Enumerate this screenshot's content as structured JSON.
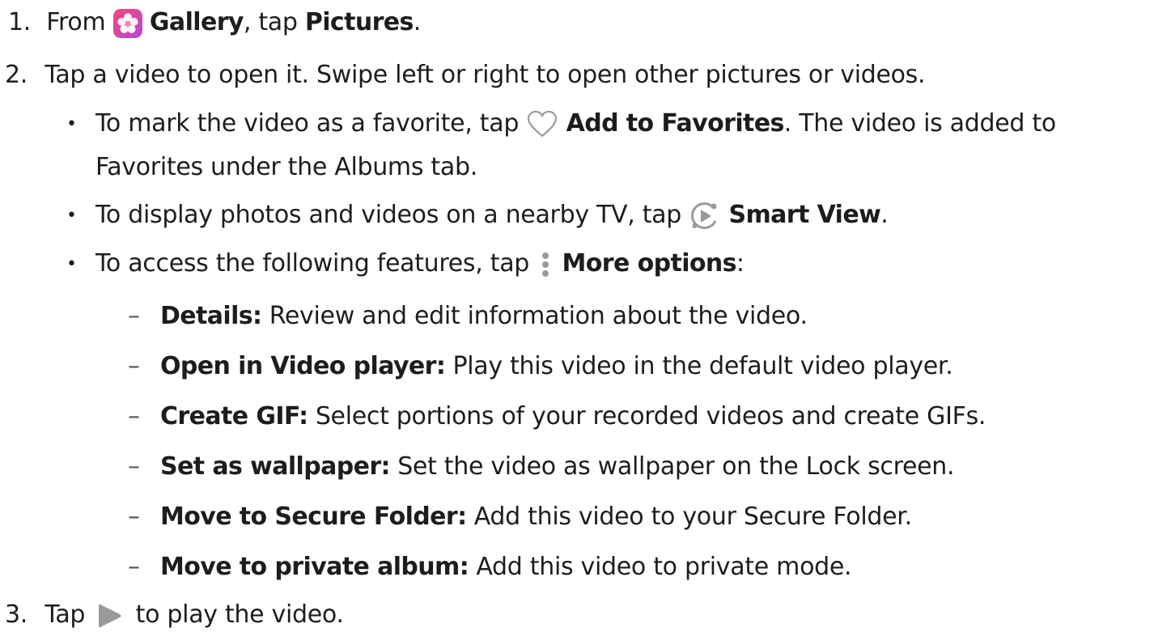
{
  "steps": [
    {
      "num": "1.",
      "pre": "From ",
      "app": "Gallery",
      "mid": ", tap ",
      "target": "Pictures",
      "post": "."
    },
    {
      "num": "2.",
      "text": "Tap a video to open it. Swipe left or right to open other pictures or videos."
    },
    {
      "num": "3.",
      "pre": "Tap ",
      "post": " to play the video."
    }
  ],
  "bullets": [
    {
      "pre": "To mark the video as a favorite, tap ",
      "bold": "Add to Favorites",
      "post": ". The video is added to",
      "cont": "Favorites under the Albums tab.",
      "icon": "heart-icon"
    },
    {
      "pre": "To display photos and videos on a nearby TV, tap ",
      "bold": "Smart View",
      "post": ".",
      "icon": "smart-view-icon"
    },
    {
      "pre": "To access the following features, tap ",
      "bold": "More options",
      "post": ":",
      "icon": "more-options-icon"
    }
  ],
  "options": [
    {
      "bold": "Details:",
      "text": " Review and edit information about the video."
    },
    {
      "bold": "Open in Video player:",
      "text": " Play this video in the default video player."
    },
    {
      "bold": "Create GIF:",
      "text": " Select portions of your recorded videos and create GIFs."
    },
    {
      "bold": "Set as wallpaper:",
      "text": " Set the video as wallpaper on the Lock screen."
    },
    {
      "bold": "Move to Secure Folder:",
      "text": " Add this video to your Secure Folder."
    },
    {
      "bold": "Move to private album:",
      "text": " Add this video to private mode."
    }
  ],
  "icons": {
    "gallery": "gallery-app-icon",
    "play": "play-icon"
  },
  "colors": {
    "gallery_gradient": [
      "#f5457a",
      "#a855f7"
    ],
    "icon_gray": "#9a9a9a",
    "text": "#1d1d1f"
  }
}
